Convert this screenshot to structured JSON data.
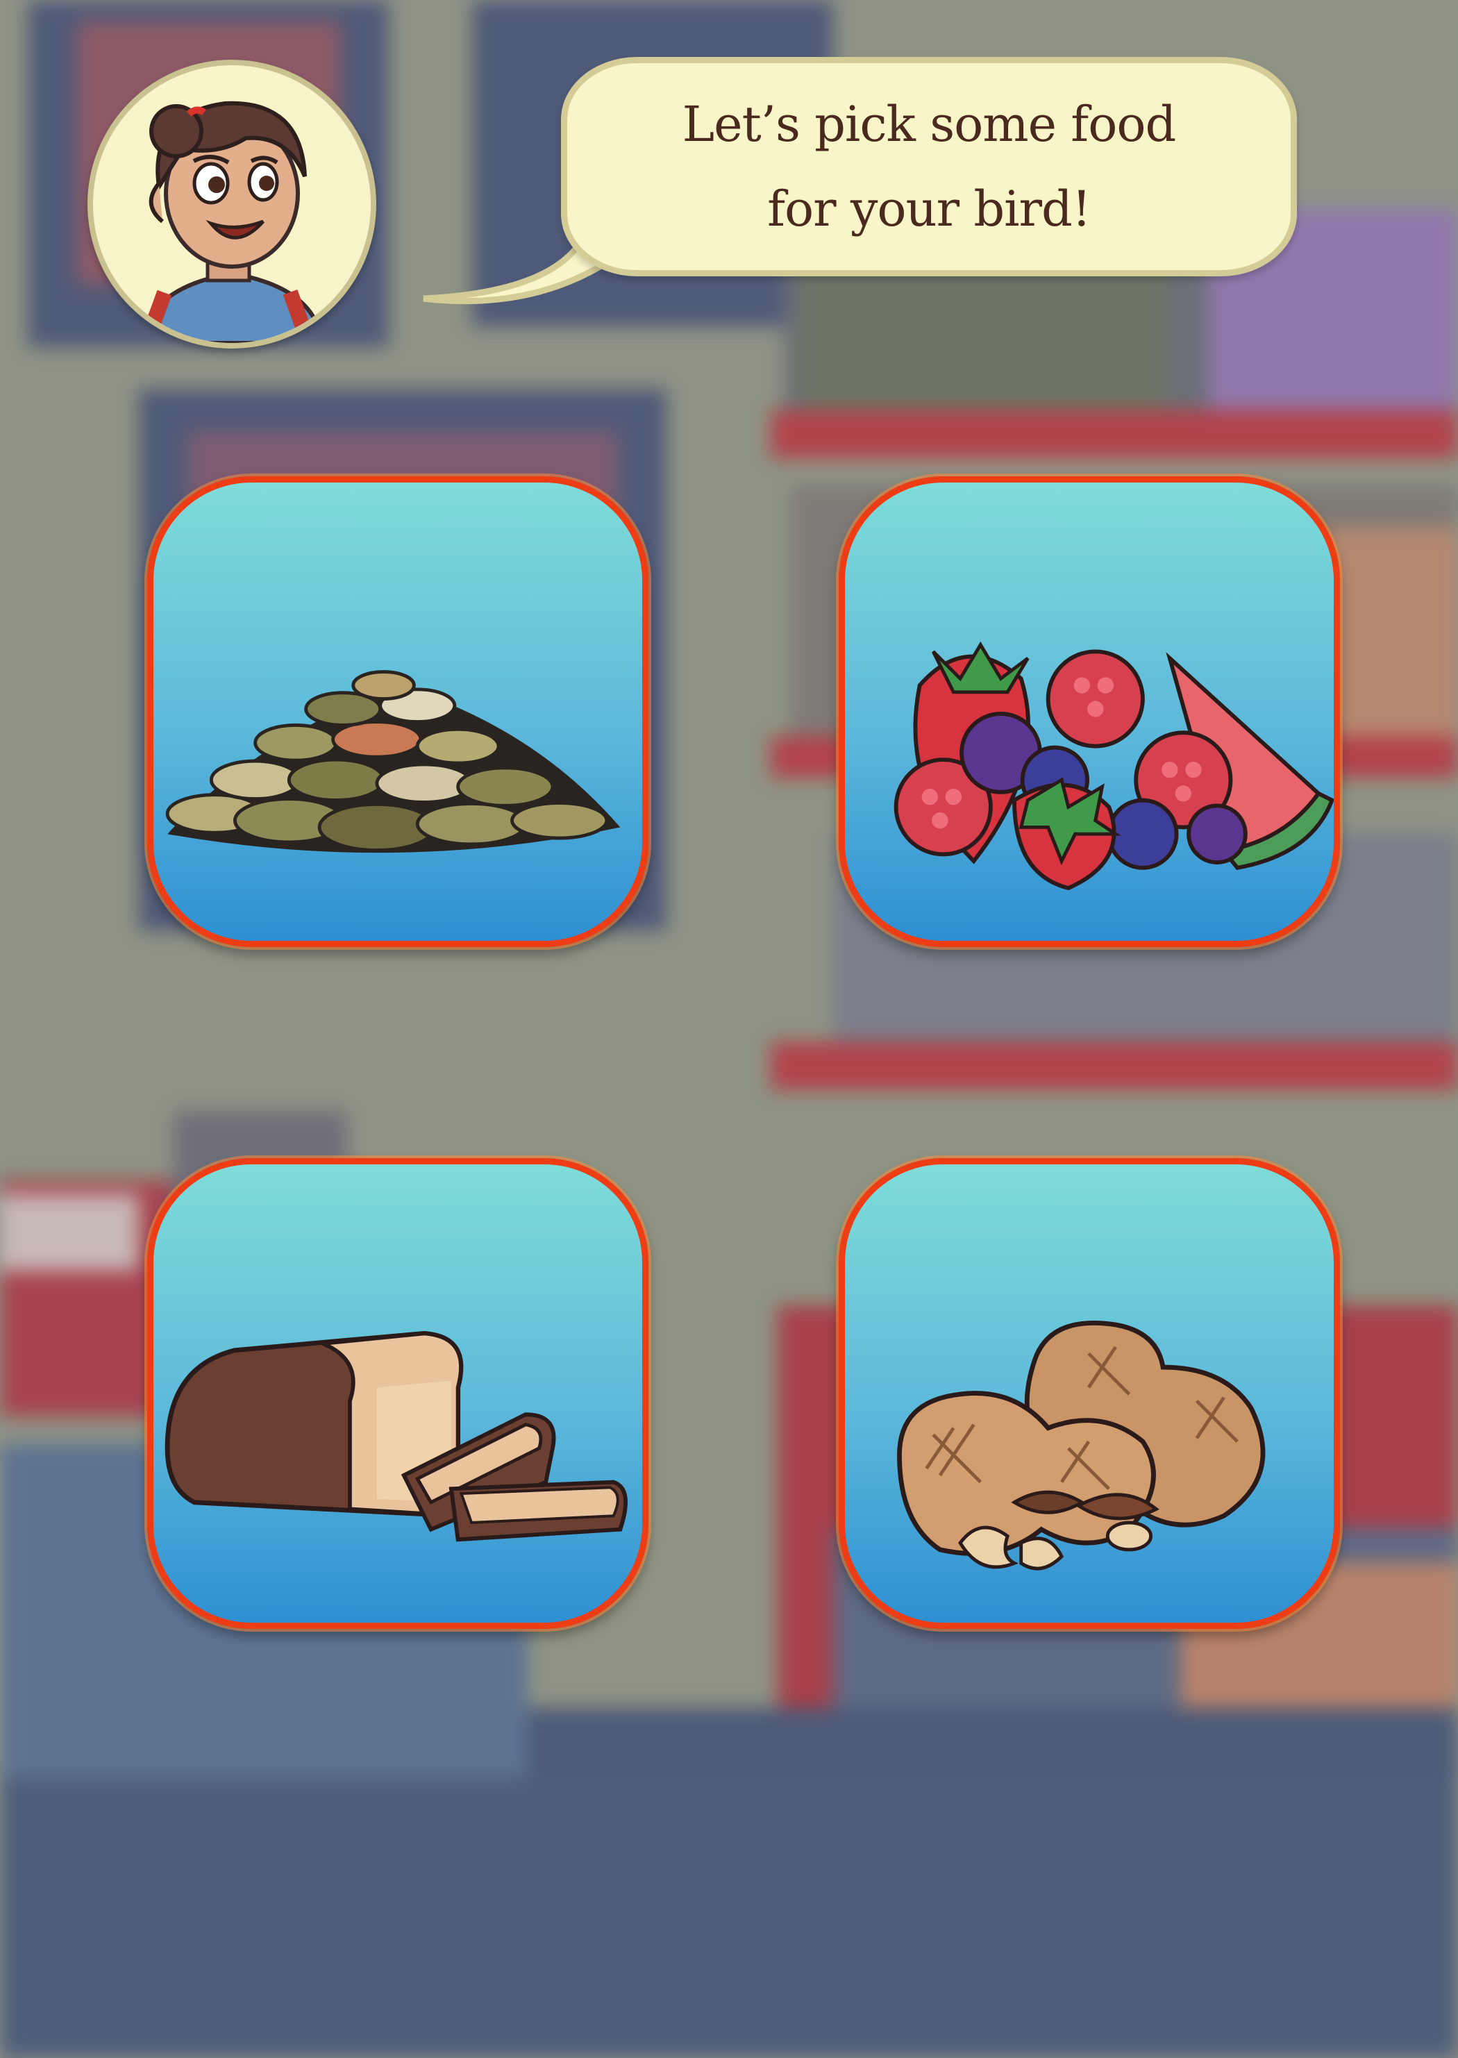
{
  "host": {
    "avatar_icon": "girl-host-avatar-icon"
  },
  "dialog": {
    "text": "Let’s pick some food for your bird!"
  },
  "food_options": [
    {
      "id": "seeds",
      "icon": "seed-pile-icon"
    },
    {
      "id": "fruit",
      "icon": "berries-fruit-icon"
    },
    {
      "id": "bread",
      "icon": "bread-loaf-icon"
    },
    {
      "id": "nuts",
      "icon": "peanuts-nuts-icon"
    }
  ],
  "colors": {
    "tile_border": "#ee3c14",
    "tile_top": "#7fdcd8",
    "tile_bottom": "#2e8fd2",
    "bubble_fill": "#f8f6c8",
    "bubble_text": "#4a2a1e"
  }
}
